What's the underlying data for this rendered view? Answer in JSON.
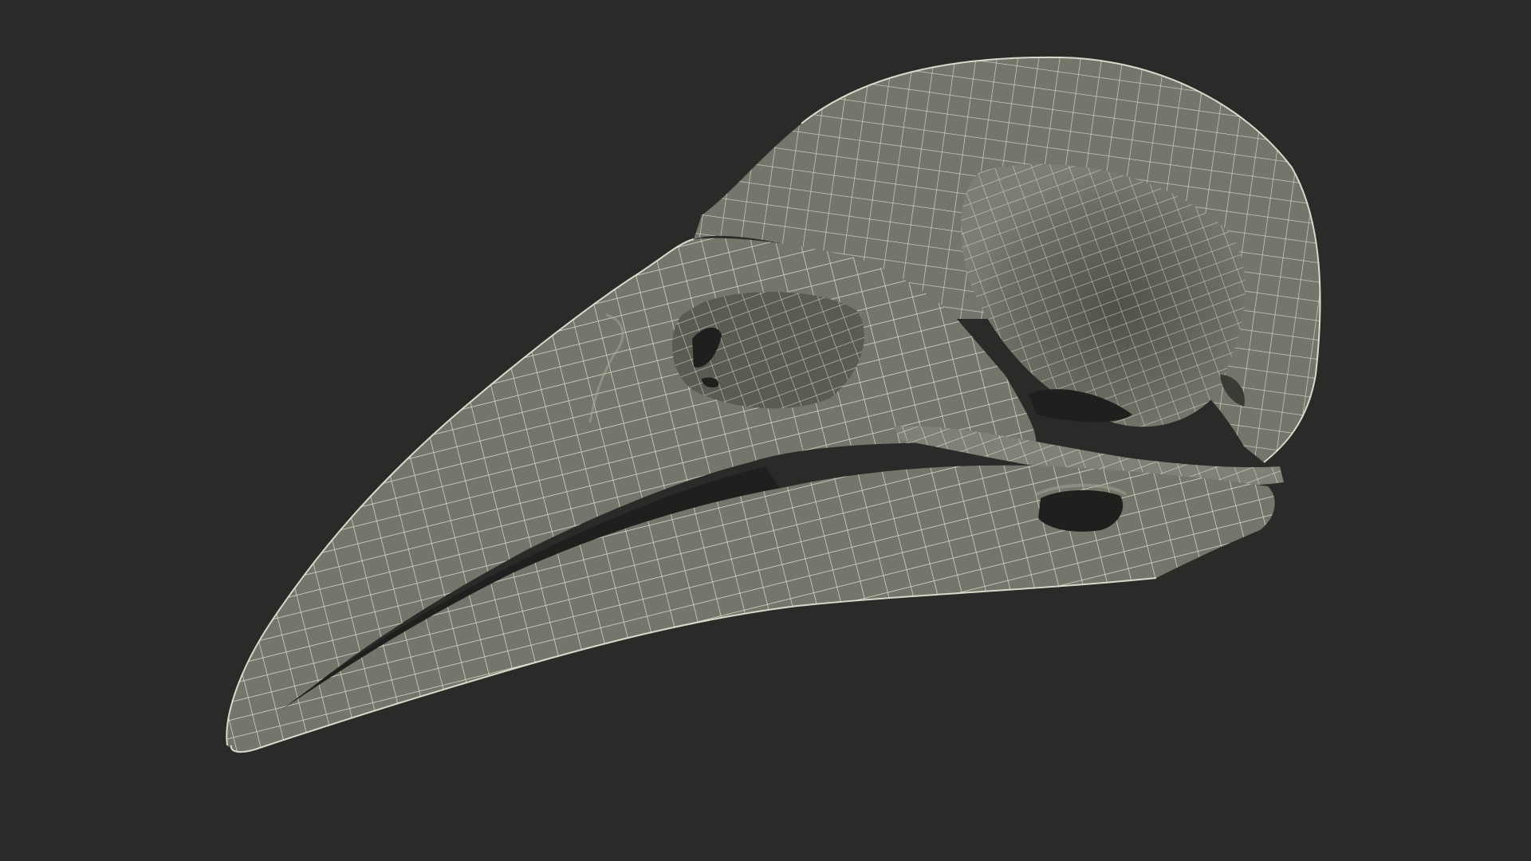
{
  "scene": {
    "subject_icon": "bird-skull-wireframe-icon",
    "colors": {
      "background": "#2a2a28",
      "bone_fill": "#75766b",
      "bone_light": "#8a8b80",
      "bone_shadow": "#56574e",
      "cavity": "#1f1f1d",
      "wire": "#e9e8d8"
    }
  }
}
